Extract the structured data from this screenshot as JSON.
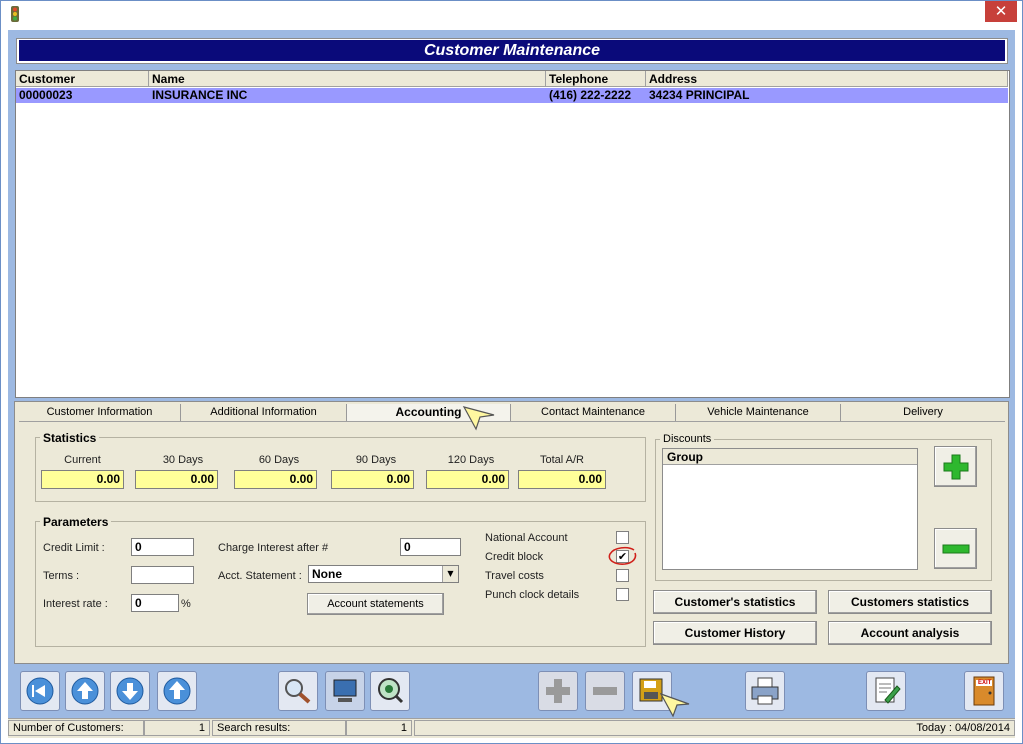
{
  "window": {
    "close_glyph": "✕"
  },
  "header": {
    "title": "Customer Maintenance"
  },
  "grid": {
    "columns": [
      "Customer",
      "Name",
      "Telephone",
      "Address"
    ],
    "rows": [
      [
        "00000023",
        "INSURANCE INC",
        "(416) 222-2222",
        "34234 PRINCIPAL"
      ]
    ]
  },
  "tabs": [
    "Customer Information",
    "Additional Information",
    "Accounting",
    "Contact Maintenance",
    "Vehicle Maintenance",
    "Delivery"
  ],
  "statistics": {
    "title": "Statistics",
    "labels": [
      "Current",
      "30 Days",
      "60 Days",
      "90 Days",
      "120 Days",
      "Total A/R"
    ],
    "values": [
      "0.00",
      "0.00",
      "0.00",
      "0.00",
      "0.00",
      "0.00"
    ]
  },
  "parameters": {
    "title": "Parameters",
    "credit_limit_label": "Credit Limit :",
    "credit_limit": "0",
    "terms_label": "Terms :",
    "terms": "",
    "interest_rate_label": "Interest rate :",
    "interest_rate": "0",
    "percent": "%",
    "charge_interest_label": "Charge Interest after #",
    "charge_interest": "0",
    "acct_statement_label": "Acct. Statement :",
    "acct_statement": "None",
    "account_statements_btn": "Account statements",
    "national_account": "National Account",
    "credit_block": "Credit block",
    "travel_costs": "Travel costs",
    "punch_clock": "Punch clock details",
    "checks": {
      "national_account": false,
      "credit_block": true,
      "travel_costs": false,
      "punch_clock": false
    }
  },
  "discounts": {
    "title": "Discounts",
    "column": "Group"
  },
  "buttons": {
    "customers_statistics_single": "Customer's statistics",
    "customers_statistics": "Customers statistics",
    "customer_history": "Customer History",
    "account_analysis": "Account analysis"
  },
  "toolbar": {
    "icons": [
      "first-record-icon",
      "previous-record-icon",
      "next-record-icon",
      "last-record-icon",
      "search-icon",
      "screen-icon",
      "view-icon",
      "add-icon",
      "remove-icon",
      "save-icon",
      "print-icon",
      "edit-document-icon",
      "exit-icon"
    ],
    "exit_text": "EXIT"
  },
  "status": {
    "customers_label": "Number of Customers:",
    "customers_count": "1",
    "search_label": "Search results:",
    "search_count": "1",
    "today": "Today : 04/08/2014"
  },
  "colors": {
    "accent": "#0a0a7a",
    "selection": "#9999ff",
    "highlight": "#ffff99",
    "client": "#9db9e2",
    "panel": "#ece9d8"
  }
}
